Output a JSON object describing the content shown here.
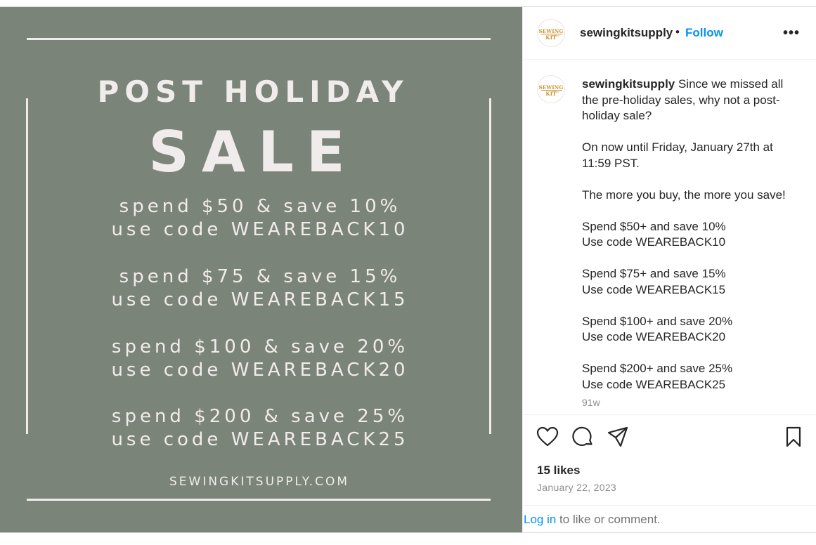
{
  "image": {
    "background_color": "#7b8478",
    "text_color": "#f1ecec",
    "title_line1": "POST HOLIDAY",
    "title_line2": "SALE",
    "offers": [
      {
        "line1": "spend $50 & save 10%",
        "line2": "use code WEAREBACK10"
      },
      {
        "line1": "spend $75 & save 15%",
        "line2": "use code WEAREBACK15"
      },
      {
        "line1": "spend $100 & save 20%",
        "line2": "use code WEAREBACK20"
      },
      {
        "line1": "spend $200 & save 25%",
        "line2": "use code WEAREBACK25"
      }
    ],
    "website": "SEWINGKITSUPPLY.COM"
  },
  "avatar": {
    "logo_text": "SEWING KIT",
    "logo_sub": "SUPPLY",
    "logo_color": "#c9932e"
  },
  "header": {
    "username": "sewingkitsupply",
    "separator": "•",
    "follow_label": "Follow",
    "more_label": "•••",
    "follow_color": "#0095f6"
  },
  "caption": {
    "username": "sewingkitsupply",
    "text": " Since we missed all the pre-holiday sales, why not a post-holiday sale?\n\nOn now until Friday, January 27th at 11:59 PST.\n\nThe more you buy, the more you save!\n\nSpend $50+ and save 10%\nUse code WEAREBACK10\n\nSpend $75+ and save 15%\nUse code WEAREBACK15\n\nSpend $100+ and save 20%\nUse code WEAREBACK20\n\nSpend $200+ and save 25%\nUse code WEAREBACK25",
    "time_ago": "91w"
  },
  "actions": {
    "icons": [
      "heart-icon",
      "comment-icon",
      "share-icon",
      "bookmark-icon"
    ],
    "likes": "15 likes",
    "date": "January 22, 2023"
  },
  "footer": {
    "login_label": "Log in",
    "rest_text": " to like or comment."
  }
}
